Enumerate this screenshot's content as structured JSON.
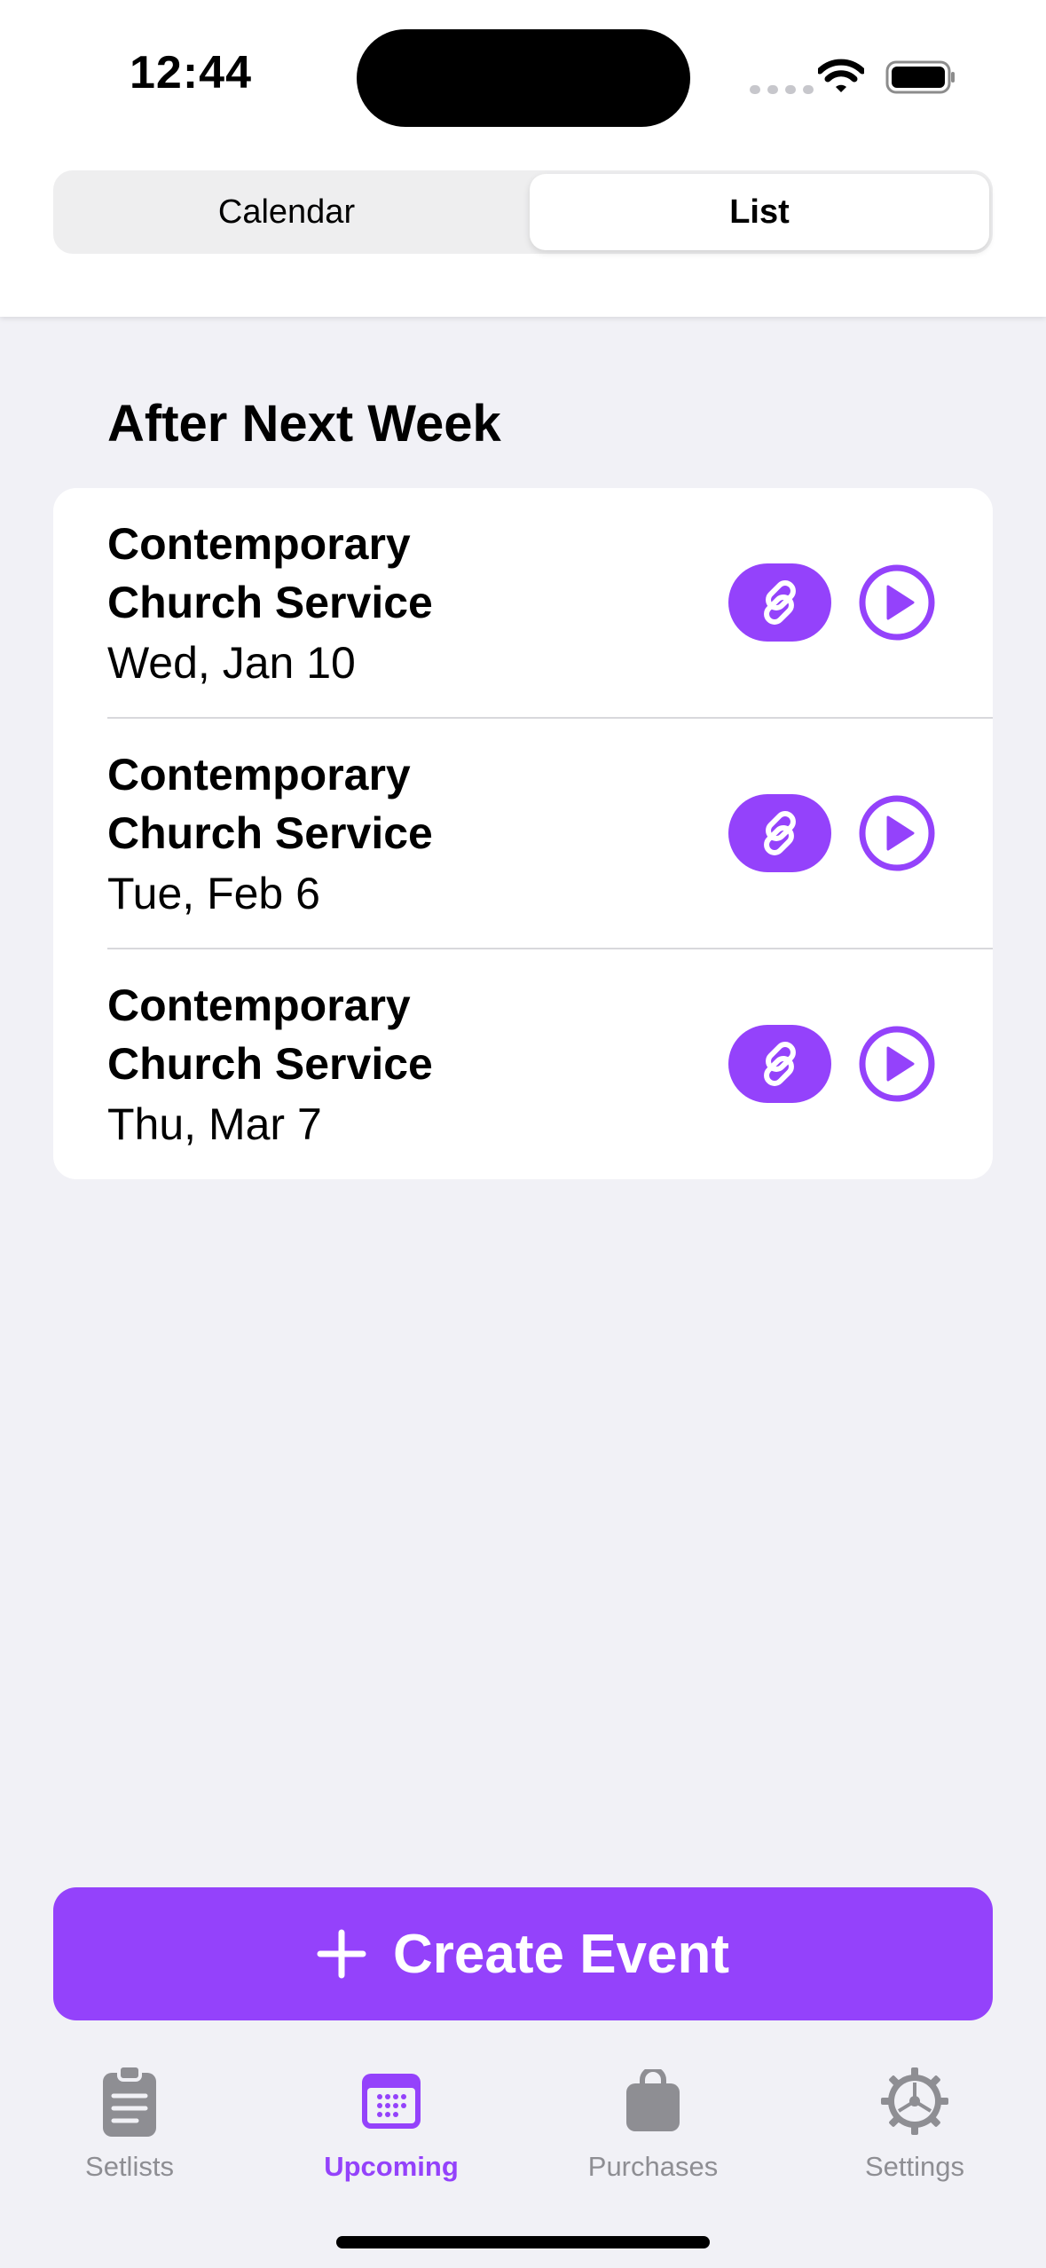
{
  "status_bar": {
    "time": "12:44"
  },
  "segmented": {
    "calendar_label": "Calendar",
    "list_label": "List",
    "selected": "List"
  },
  "section": {
    "title": "After Next Week"
  },
  "events": [
    {
      "title": "Contemporary Church Service",
      "date": "Wed, Jan 10"
    },
    {
      "title": "Contemporary Church Service",
      "date": "Tue, Feb 6"
    },
    {
      "title": "Contemporary Church Service",
      "date": "Thu, Mar 7"
    }
  ],
  "create_button": {
    "label": "Create Event",
    "icon": "plus-icon"
  },
  "tabbar": {
    "items": [
      {
        "label": "Setlists",
        "icon": "clipboard-icon"
      },
      {
        "label": "Upcoming",
        "icon": "calendar-icon",
        "active": true
      },
      {
        "label": "Purchases",
        "icon": "bag-icon"
      },
      {
        "label": "Settings",
        "icon": "gear-icon"
      }
    ]
  },
  "colors": {
    "accent": "#9442fb",
    "inactive": "#8e8e93",
    "background": "#f1f1f6"
  }
}
